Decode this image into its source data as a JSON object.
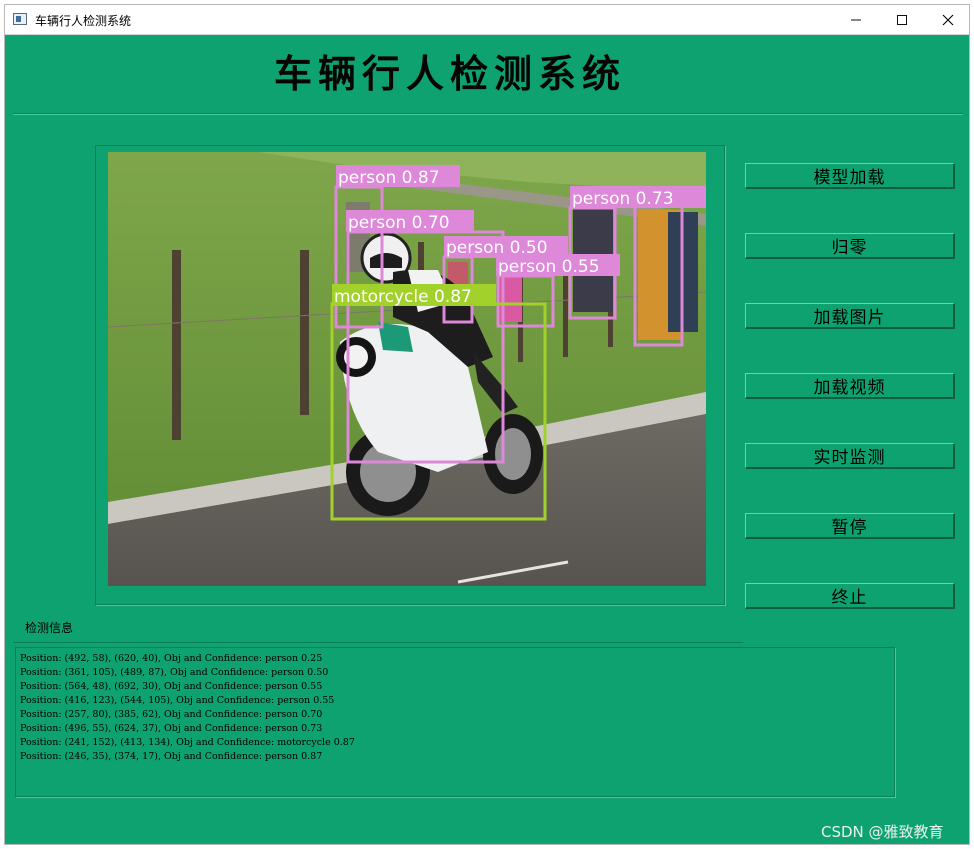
{
  "window": {
    "title": "车辆行人检测系统",
    "controls": [
      "minimize-icon",
      "maximize-icon",
      "close-icon"
    ]
  },
  "header": {
    "title": "车辆行人检测系统"
  },
  "buttons": {
    "load_model": "模型加载",
    "reset": "归零",
    "load_image": "加载图片",
    "load_video": "加载视频",
    "realtime": "实时监测",
    "pause": "暂停",
    "stop": "终止"
  },
  "detections": {
    "labels": [
      "person 0.87",
      "person 0.70",
      "person 0.50",
      "person 0.55",
      "person 0.73",
      "motorcycle 0.87"
    ],
    "colors": {
      "person": "#dd88d8",
      "motorcycle": "#a3d12c"
    }
  },
  "info": {
    "label": "检测信息",
    "lines": [
      "Position: (492, 58), (620, 40), Obj and Confidence: person 0.25",
      "Position: (361, 105), (489, 87), Obj and Confidence: person 0.50",
      "Position: (564, 48), (692, 30), Obj and Confidence: person 0.55",
      "Position: (416, 123), (544, 105), Obj and Confidence: person 0.55",
      "Position: (257, 80), (385, 62), Obj and Confidence: person 0.70",
      "Position: (496, 55), (624, 37), Obj and Confidence: person 0.73",
      "Position: (241, 152), (413, 134), Obj and Confidence: motorcycle 0.87",
      "Position: (246, 35), (374, 17), Obj and Confidence: person 0.87"
    ]
  },
  "watermark": "CSDN @雅致教育"
}
